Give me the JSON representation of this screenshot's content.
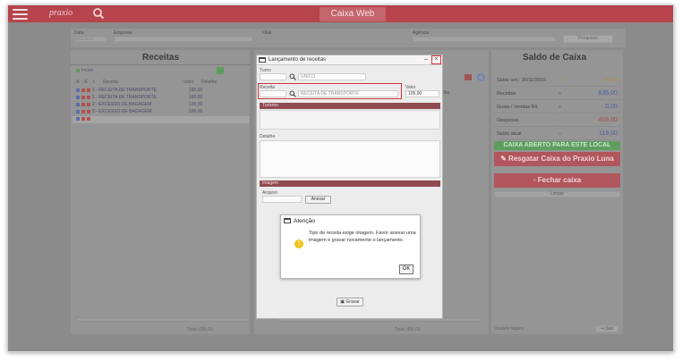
{
  "header": {
    "logo": "praxio",
    "title": "Caixa Web"
  },
  "filters": {
    "data_label": "Data",
    "data_value": "30/11/2015",
    "empresa_label": "Empresa",
    "filial_label": "Filial",
    "agencia_label": "Agência",
    "pesquisar_label": "Pesquisar"
  },
  "receitas": {
    "title": "Receitas",
    "add_label": "Incluir",
    "columns": [
      "A",
      "E",
      "I",
      "Receita",
      "Valor",
      "Detalhe"
    ],
    "rows": [
      {
        "name": "1 - RECEITA DE TRANSPORTE",
        "value": "180,00"
      },
      {
        "name": "1 - RECEITA DE TRANSPORTE",
        "value": "180,00"
      },
      {
        "name": "2 - EXCESSO DE BAGAGEM",
        "value": "100,00"
      },
      {
        "name": "2 - EXCESSO DE BAGAGEM",
        "value": "100,00"
      },
      {
        "name": "",
        "value": ""
      }
    ],
    "total": "Total: 635,00"
  },
  "middle": {
    "col_label": "Obs",
    "total": "Total: 405,00"
  },
  "saldo": {
    "title": "Saldo de Caixa",
    "rows": [
      {
        "label": "Saldo ant.: 30/11/2015",
        "sign": "",
        "value": "-80,00",
        "color": "#b88a3a"
      },
      {
        "label": "Receitas",
        "sign": "+",
        "value": "635,00",
        "color": "#4a5fa8"
      },
      {
        "label": "Guias / Vendas Bil.",
        "sign": "+",
        "value": "0,00",
        "color": "#4a5fa8"
      },
      {
        "label": "Despesas",
        "sign": "-",
        "value": "405,00",
        "color": "#a84a4a"
      },
      {
        "label": "Saldo atual",
        "sign": "",
        "value": "119,00",
        "color": "#4a5fa8"
      }
    ],
    "status": "CAIXA ABERTO PARA ESTE LOCAL",
    "resgatar": "Resgatar Caixa do Praxio Luna",
    "fechar": "Fechar caixa",
    "limpar": "Limpar",
    "usuario": "Usuário logado",
    "sair": "Sair"
  },
  "modal": {
    "title": "Lançamento de receitas",
    "turno_label": "Turno",
    "turno_value": "UNICO",
    "receita_label": "Receita",
    "receita_value": "RECEITA DE TRANSPORTE",
    "valor_label": "Valor",
    "valor_value": "105,00",
    "turismo_label": "Turismo",
    "detalhe_label": "Detalhe",
    "imagem_label": "Imagem",
    "arquivo_label": "Arquivo",
    "anexar_label": "Anexar",
    "gravar_label": "Gravar",
    "minimize": "–",
    "close": "×"
  },
  "alert": {
    "title": "Atenção",
    "message": "Tipo de receita exige imagem. Favor anexar uma imagem e gravar novamente o lançamento.",
    "ok": "OK"
  },
  "colors": {
    "brand": "#b7434c",
    "highlight": "#d8323a",
    "warning": "#f1c21b"
  }
}
